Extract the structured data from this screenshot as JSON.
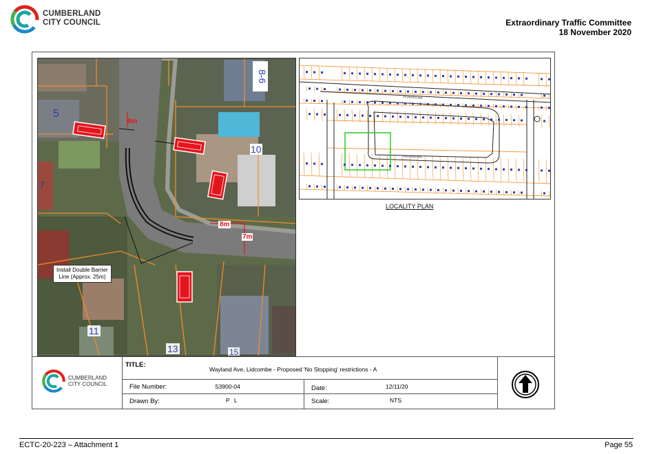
{
  "header": {
    "logo_line1": "CUMBERLAND",
    "logo_line2": "CITY COUNCIL",
    "committee": "Extraordinary Traffic Committee",
    "date": "18 November 2020"
  },
  "aerial": {
    "dim_6m": "6m",
    "dim_8m": "8m",
    "dim_7m": "7m",
    "callout_line1": "Install Double Barrier",
    "callout_line2": "Line (Approx. 25m)",
    "lot_numbers": [
      "8-6",
      "5",
      "10",
      "7",
      "11",
      "13",
      "15"
    ],
    "sign_proposed": "PROPOSED"
  },
  "locality": {
    "caption": "LOCALITY PLAN",
    "street_georges": "GEORGES AVE",
    "street_wayland": "WAYLAND AVE"
  },
  "title_block": {
    "logo_line1": "CUMBERLAND",
    "logo_line2": "CITY COUNCIL",
    "title_label": "TITLE:",
    "title_value": "Wayland Ave, Lidcombe - Proposed 'No Stopping' restrictions - A",
    "file_number_label": "File Number:",
    "file_number_value": "S3900-04",
    "date_label": "Date:",
    "date_value": "12/11/20",
    "drawn_by_label": "Drawn By:",
    "drawn_by_value": "P L",
    "scale_label": "Scale:",
    "scale_value": "NTS"
  },
  "footer": {
    "left": "ECTC-20-223 – Attachment 1",
    "right": "Page 55"
  },
  "colors": {
    "logo_red": "#e2231a",
    "logo_green": "#4caf50",
    "logo_blue": "#1e88c8",
    "logo_teal": "#1aa6a0",
    "restriction_red": "#e5151d",
    "boundary_orange": "#f28c28",
    "locality_green": "#22cc22"
  }
}
